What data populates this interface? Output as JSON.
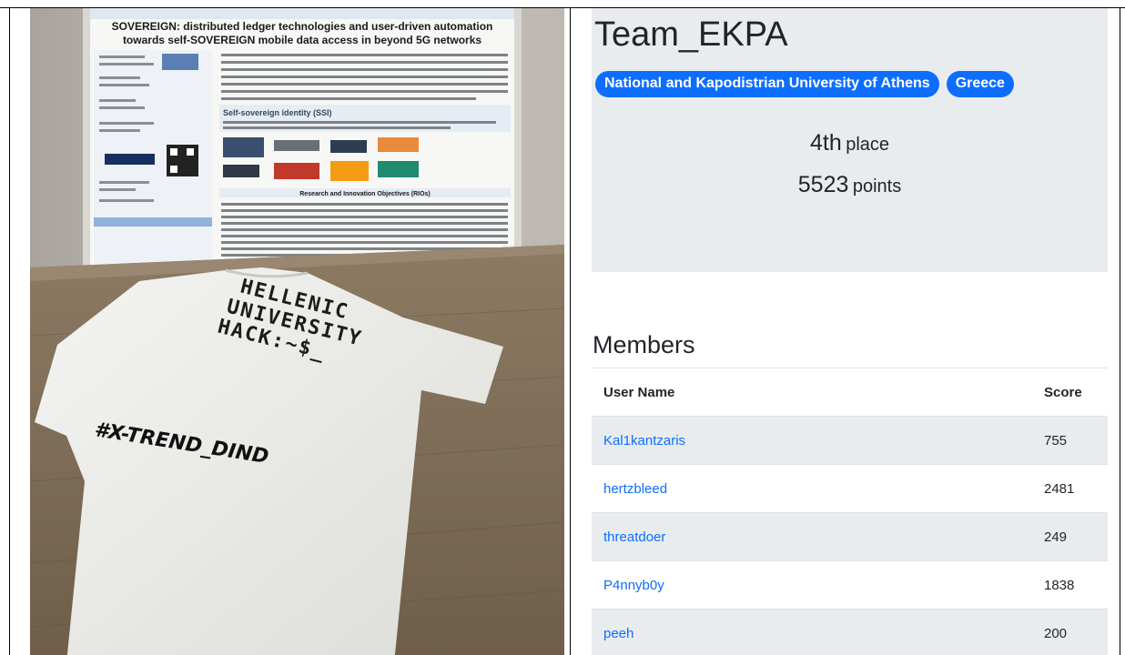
{
  "team": {
    "name": "Team_EKPA",
    "badges": [
      "National and Kapodistrian University of Athens",
      "Greece"
    ],
    "rank_value": "4th",
    "rank_label": "place",
    "points_value": "5523",
    "points_label": "points"
  },
  "members": {
    "title": "Members",
    "headers": {
      "username": "User Name",
      "score": "Score"
    },
    "rows": [
      {
        "username": "Kal1kantzaris",
        "score": "755"
      },
      {
        "username": "hertzbleed",
        "score": "2481"
      },
      {
        "username": "threatdoer",
        "score": "249"
      },
      {
        "username": "P4nnyb0y",
        "score": "1838"
      },
      {
        "username": "peeh",
        "score": "200"
      }
    ]
  },
  "photo": {
    "poster_title_line1": "SOVEREIGN: distributed ledger technologies and user-driven automation",
    "poster_title_line2": "towards self-SOVEREIGN mobile data access in beyond 5G networks",
    "poster_section": "Self-sovereign identity (SSI)",
    "poster_objectives": "Research and Innovation Objectives (RIOs)",
    "shirt_line1": "HELLENIC",
    "shirt_line2": "UNIVERSITY",
    "shirt_line3": "HACK:~$_",
    "shirt_hashtag": "#X-TREND_DIND"
  },
  "colors": {
    "badge": "#0d6efd",
    "link": "#0d6efd",
    "header_bg": "#e9ecef"
  }
}
